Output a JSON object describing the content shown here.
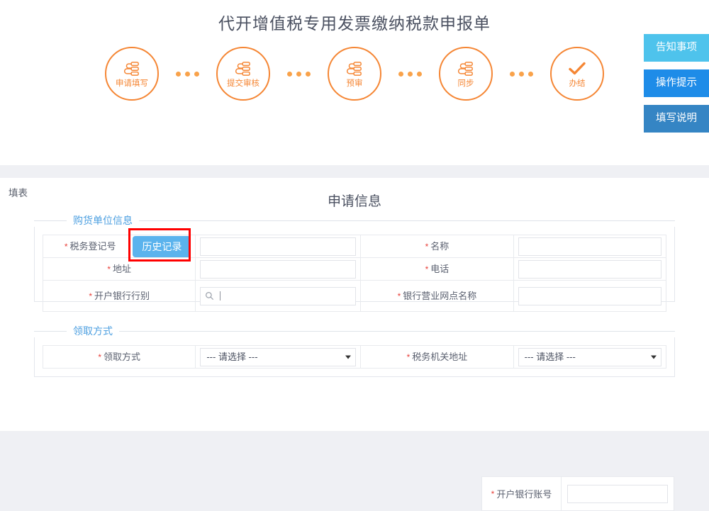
{
  "page": {
    "title": "代开增值税专用发票缴纳税款申报单"
  },
  "stepper": {
    "steps": [
      {
        "label": "申请填写",
        "icon": "sitemap-icon"
      },
      {
        "label": "提交审核",
        "icon": "sitemap-icon"
      },
      {
        "label": "预审",
        "icon": "sitemap-icon"
      },
      {
        "label": "同步",
        "icon": "sitemap-icon"
      },
      {
        "label": "办结",
        "icon": "check-icon"
      }
    ],
    "separator_icon": "three-dots-icon",
    "accent_color": "#f58634"
  },
  "side_buttons": [
    {
      "label": "告知事项",
      "color": "#4ec3ec"
    },
    {
      "label": "操作提示",
      "color": "#1e8ce8"
    },
    {
      "label": "填写说明",
      "color": "#3585c4"
    }
  ],
  "tab": {
    "label": "填表"
  },
  "form": {
    "section_title": "申请信息",
    "buyer_group": {
      "legend": "购货单位信息",
      "legend_color": "#4c9fe0",
      "rows": [
        {
          "label_1": "税务登记号",
          "button_1": "历史记录",
          "value_1": "",
          "label_2": "名称",
          "value_2": ""
        },
        {
          "label_1": "地址",
          "value_1": "",
          "label_2": "电话",
          "value_2": ""
        },
        {
          "label_1": "开户银行行别",
          "value_1": "",
          "label_2": "银行营业网点名称",
          "value_2": "",
          "label_3": "开户银行账号",
          "value_3": ""
        }
      ],
      "search_icon": "magnifier-icon",
      "highlight_target": "历史记录",
      "highlight_color": "#ff0000"
    },
    "delivery_group": {
      "legend": "领取方式",
      "rows": [
        {
          "label_1": "领取方式",
          "value_1": "--- 请选择 ---",
          "options_1": [
            "--- 请选择 ---"
          ],
          "label_2": "税务机关地址",
          "value_2": "--- 请选择 ---",
          "options_2": [
            "--- 请选择 ---"
          ]
        }
      ]
    }
  }
}
